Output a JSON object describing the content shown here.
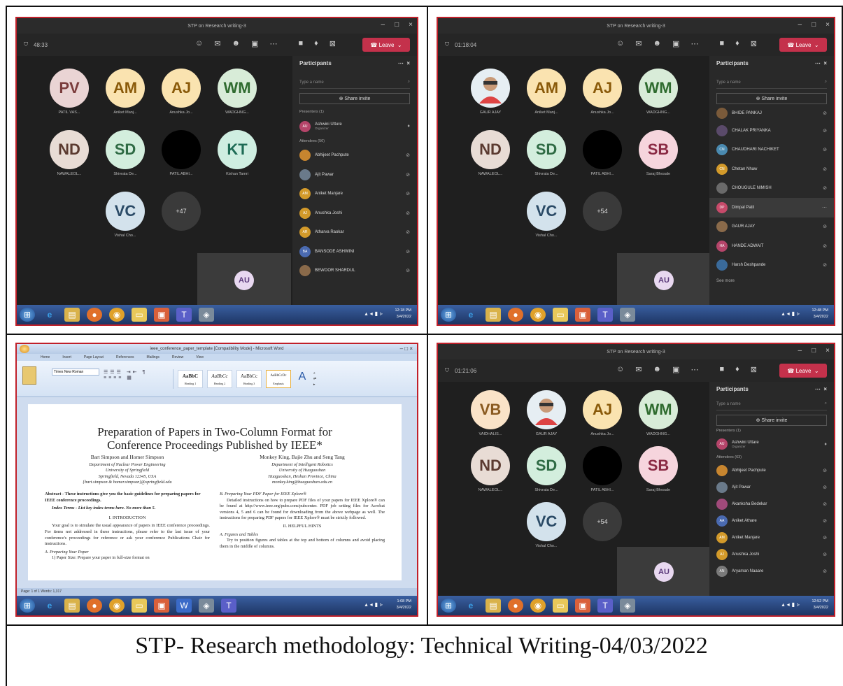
{
  "caption": "STP- Research methodology: Technical Writing-04/03/2022",
  "teams": {
    "title": "STP on Research writing-3",
    "leave": "Leave",
    "participants_header": "Participants",
    "search_placeholder": "Type a name",
    "share_invite": "Share invite",
    "self_initials": "AU",
    "colors": {
      "leave": "#c4314b",
      "border": "#c0202a",
      "bg": "#1f1f1f"
    }
  },
  "panel1": {
    "timer": "48:33",
    "tiles": [
      {
        "initials": "PV",
        "name": "PATIL VAS...",
        "bg": "#ead4d4",
        "fg": "#7a3b3b"
      },
      {
        "initials": "AM",
        "name": "Aniket Manj...",
        "bg": "#fae3b0",
        "fg": "#8a5a0a"
      },
      {
        "initials": "AJ",
        "name": "Anushka Jo...",
        "bg": "#fae3b0",
        "fg": "#8a5a0a"
      },
      {
        "initials": "WM",
        "name": "WADGHNG...",
        "bg": "#d8ecd8",
        "fg": "#2f6b2f"
      },
      {
        "initials": "ND",
        "name": "NAWALEOL...",
        "bg": "#e8dcd5",
        "fg": "#5b3a30"
      },
      {
        "initials": "SD",
        "name": "Shivrata De...",
        "bg": "#d3eedd",
        "fg": "#2f6b44"
      },
      {
        "initials": "",
        "name": "PATIL ABHI...",
        "bg": "#000000",
        "fg": "#000000"
      },
      {
        "initials": "KT",
        "name": "Kishan Tamri",
        "bg": "#cfeee1",
        "fg": "#1e6b55"
      },
      {
        "initials": "VC",
        "name": "Vishal Cho...",
        "bg": "#d3e2ec",
        "fg": "#2a4a66"
      },
      {
        "initials": "+47",
        "name": "",
        "bg": "#3a3a3a",
        "fg": "#dddddd"
      }
    ],
    "presenters_label": "Presenters (1)",
    "presenter": {
      "name": "Ashwini Utture",
      "role": "Organizer"
    },
    "attendees_label": "Attendees (56)",
    "attendees": [
      "Abhijeet Pachpute",
      "Ajit Pawar",
      "Aniket Manjare",
      "Anushka Joshi",
      "Atharva Raokar",
      "BANSODE ASHWINI",
      "BEWOOR SHARDUL"
    ],
    "clock": "12:18 PM",
    "date": "3/4/2022"
  },
  "panel2": {
    "timer": "01:18:04",
    "tiles": [
      {
        "initials": "",
        "name": "GAUR AJAY",
        "bg": "#e6eef3",
        "fg": "#333333"
      },
      {
        "initials": "AM",
        "name": "Aniket Manj...",
        "bg": "#fae3b0",
        "fg": "#8a5a0a"
      },
      {
        "initials": "AJ",
        "name": "Anushka Jo...",
        "bg": "#fae3b0",
        "fg": "#8a5a0a"
      },
      {
        "initials": "WM",
        "name": "WADGHNG...",
        "bg": "#d8ecd8",
        "fg": "#2f6b2f"
      },
      {
        "initials": "ND",
        "name": "NAWALEOL...",
        "bg": "#e8dcd5",
        "fg": "#5b3a30"
      },
      {
        "initials": "SD",
        "name": "Shivrata De...",
        "bg": "#d3eedd",
        "fg": "#2f6b44"
      },
      {
        "initials": "",
        "name": "PATIL ABHI...",
        "bg": "#000000",
        "fg": "#000000"
      },
      {
        "initials": "SB",
        "name": "Saraj Bhosale",
        "bg": "#f6d5dd",
        "fg": "#8a2a44"
      },
      {
        "initials": "VC",
        "name": "Vishal Cho...",
        "bg": "#d3e2ec",
        "fg": "#2a4a66"
      },
      {
        "initials": "+54",
        "name": "",
        "bg": "#3a3a3a",
        "fg": "#dddddd"
      }
    ],
    "attendees": [
      "BHIDE PANKAJ",
      "CHALAK PRIYANKA",
      "CHAUDHARI NACHIKET",
      "Chetan Nhaw",
      "CHOUGULE NIMISH",
      "Dimpal Patil",
      "GAUR AJAY",
      "HANDE ADWAIT",
      "Harsh Deshpande"
    ],
    "see_more": "See more",
    "clock": "12:48 PM",
    "date": "3/4/2022"
  },
  "panel3": {
    "window_title": "ieee_conference_paper_template [Compatibility Mode] - Microsoft Word",
    "tabs": [
      "Home",
      "Insert",
      "Page Layout",
      "References",
      "Mailings",
      "Review",
      "View"
    ],
    "font_name": "Times New Roman",
    "styles": [
      "AaBbC",
      "AaBbCc",
      "AaBbCc",
      "AaBbCcDc"
    ],
    "style_names": [
      "Heading 1",
      "Heading 2",
      "Heading 3",
      "Emphasis"
    ],
    "paper_title": "Preparation of Papers in Two-Column Format for Conference Proceedings Published by IEEE*",
    "authors_left": "Bart Simpson and Homer Simpson",
    "affil_left": "Department of Nuclear Power Engineering\nUniversity of Springfield\nSpringfield, Nevada 12345, USA\n{bart.simpson & homer.simpson}@springfield.edu",
    "authors_right": "Monkey King, Bajie Zhu and Seng Tang",
    "affil_right": "Department of Intelligent Robotics\nUniversity of Huaguoshan\nHuaguoshan, Heshan Province, China\nmonkey.king@huaguoshan.edu.cn",
    "abstract": "Abstract - These instructions give you the basic guidelines for preparing papers for IEEE conference proceedings.",
    "index_terms": "Index Terms - List key index terms here. No more than 5.",
    "intro_heading": "I. INTRODUCTION",
    "intro_text": "Your goal is to simulate the usual appearance of papers in IEEE conference proceedings. For items not addressed in these instructions, please refer to the last issue of your conference's proceedings for reference or ask your conference Publications Chair for instructions.",
    "sub_a": "A. Preparing Your Paper",
    "sub_a_text": "1) Paper Size: Prepare your paper in full-size format on",
    "sub_b": "B. Preparing Your PDF Paper for IEEE Xplore®",
    "sub_b_text": "Detailed instructions on how to prepare PDF files of your papers for IEEE Xplore® can be found at http://www.ieee.org/pubs.com/pubcenter. PDF job setting files for Acrobat versions 4, 5 and 6 can be found for downloading from the above webpage as well. The instructions for preparing PDF papers for IEEE Xplore® must be strictly followed.",
    "helpful_heading": "II. HELPFUL HINTS",
    "sub_fig": "A. Figures and Tables",
    "sub_fig_text": "Try to position figures and tables at the top and bottom of columns and avoid placing them in the middle of columns.",
    "status": "Page: 1 of 1   Words: 1,317",
    "clock": "1:08 PM",
    "date": "3/4/2022"
  },
  "panel4": {
    "timer": "01:21:06",
    "tiles": [
      {
        "initials": "VB",
        "name": "VAIDHALIS...",
        "bg": "#fae3c8",
        "fg": "#8a5a20"
      },
      {
        "initials": "",
        "name": "GAUR AJAY",
        "bg": "#e6eef3",
        "fg": "#333333"
      },
      {
        "initials": "AJ",
        "name": "Anushka Jo...",
        "bg": "#fae3b0",
        "fg": "#8a5a0a"
      },
      {
        "initials": "WM",
        "name": "WADGHNG...",
        "bg": "#d8ecd8",
        "fg": "#2f6b2f"
      },
      {
        "initials": "ND",
        "name": "NAWALEOL...",
        "bg": "#e8dcd5",
        "fg": "#5b3a30"
      },
      {
        "initials": "SD",
        "name": "Shivrata De...",
        "bg": "#d3eedd",
        "fg": "#2f6b44"
      },
      {
        "initials": "",
        "name": "PATIL ABHI...",
        "bg": "#000000",
        "fg": "#000000"
      },
      {
        "initials": "SB",
        "name": "Saraj Bhosale",
        "bg": "#f6d5dd",
        "fg": "#8a2a44"
      },
      {
        "initials": "VC",
        "name": "Vishal Cho...",
        "bg": "#d3e2ec",
        "fg": "#2a4a66"
      },
      {
        "initials": "+54",
        "name": "",
        "bg": "#3a3a3a",
        "fg": "#dddddd"
      }
    ],
    "presenters_label": "Presenters (1)",
    "presenter": {
      "name": "Ashwini Uttare",
      "role": "Organizer"
    },
    "attendees_label": "Attendees (63)",
    "attendees": [
      "Abhijeet Pachpute",
      "Ajit Pawar",
      "Akanksha Bedekar",
      "Aniket Athare",
      "Aniket Manjare",
      "Anushka Joshi",
      "Aryaman Naaare"
    ],
    "clock": "12:52 PM",
    "date": "3/4/2022"
  }
}
